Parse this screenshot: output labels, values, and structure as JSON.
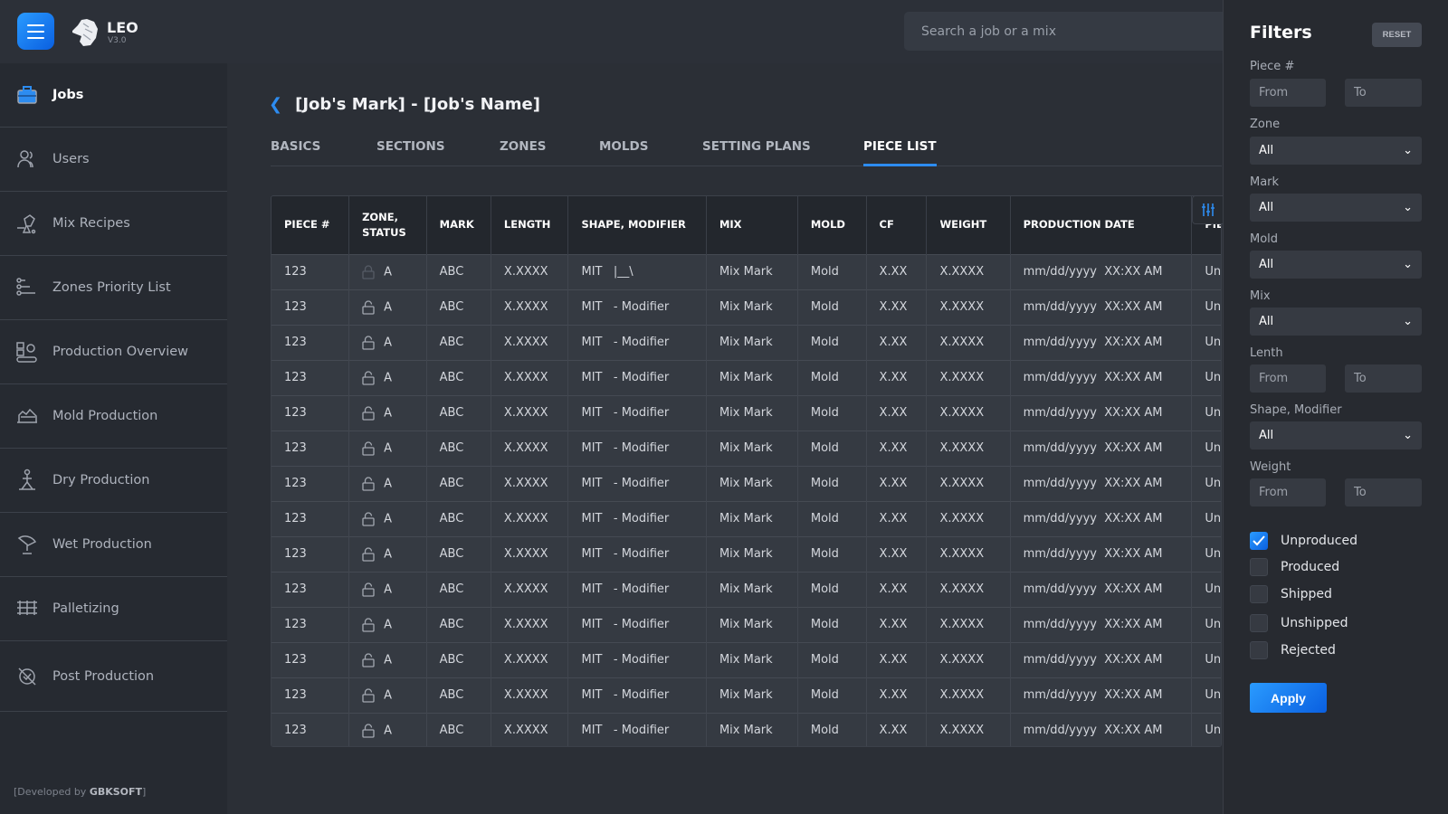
{
  "app": {
    "name": "LEO",
    "version": "V3.0",
    "search_placeholder": "Search a job or a mix"
  },
  "colors": {
    "accent": "#2d8cf0",
    "background": "#2b2f36",
    "sidebar": "#262a31"
  },
  "sidebar": {
    "items": [
      {
        "label": "Jobs",
        "icon": "briefcase-icon",
        "active": true
      },
      {
        "label": "Users",
        "icon": "users-icon"
      },
      {
        "label": "Mix Recipes",
        "icon": "mixer-icon"
      },
      {
        "label": "Zones Priority List",
        "icon": "priority-list-icon"
      },
      {
        "label": "Production Overview",
        "icon": "production-overview-icon"
      },
      {
        "label": "Mold Production",
        "icon": "mold-icon"
      },
      {
        "label": "Dry Production",
        "icon": "dry-production-icon"
      },
      {
        "label": "Wet Production",
        "icon": "wet-production-icon"
      },
      {
        "label": "Palletizing",
        "icon": "pallet-icon"
      },
      {
        "label": "Post Production",
        "icon": "post-production-icon"
      }
    ],
    "credit_prefix": "[Developed by ",
    "credit_brand": "GBKSOFT",
    "credit_suffix": "]"
  },
  "page": {
    "title": "[Job's Mark] - [Job's Name]",
    "tabs": [
      {
        "label": "BASICS"
      },
      {
        "label": "SECTIONS"
      },
      {
        "label": "ZONES"
      },
      {
        "label": "MOLDS"
      },
      {
        "label": "SETTING PLANS"
      },
      {
        "label": "PIECE LIST",
        "active": true
      }
    ]
  },
  "table": {
    "columns": [
      "PIECE #",
      "ZONE,\nSTATUS",
      "MARK",
      "LENGTH",
      "SHAPE, MODIFIER",
      "MIX",
      "MOLD",
      "CF",
      "WEIGHT",
      "PRODUCTION DATE",
      "PIECE STATUS"
    ],
    "rows": [
      {
        "piece": "123",
        "locked": true,
        "zone": "A",
        "mark": "ABC",
        "length": "X.XXXX",
        "shape": "MIT",
        "modifier": "|__\\",
        "mix": "Mix Mark",
        "mold": "Mold",
        "cf": "X.XX",
        "weight": "X.XXXX",
        "date": "mm/dd/yyyy  XX:XX AM",
        "status": "Unpalletized"
      },
      {
        "piece": "123",
        "locked": false,
        "zone": "A",
        "mark": "ABC",
        "length": "X.XXXX",
        "shape": "MIT",
        "modifier": "- Modifier",
        "mix": "Mix Mark",
        "mold": "Mold",
        "cf": "X.XX",
        "weight": "X.XXXX",
        "date": "mm/dd/yyyy  XX:XX AM",
        "status": "Unpalletized"
      },
      {
        "piece": "123",
        "locked": false,
        "zone": "A",
        "mark": "ABC",
        "length": "X.XXXX",
        "shape": "MIT",
        "modifier": "- Modifier",
        "mix": "Mix Mark",
        "mold": "Mold",
        "cf": "X.XX",
        "weight": "X.XXXX",
        "date": "mm/dd/yyyy  XX:XX AM",
        "status": "Unpalletized"
      },
      {
        "piece": "123",
        "locked": false,
        "zone": "A",
        "mark": "ABC",
        "length": "X.XXXX",
        "shape": "MIT",
        "modifier": "- Modifier",
        "mix": "Mix Mark",
        "mold": "Mold",
        "cf": "X.XX",
        "weight": "X.XXXX",
        "date": "mm/dd/yyyy  XX:XX AM",
        "status": "Unpalletized"
      },
      {
        "piece": "123",
        "locked": false,
        "zone": "A",
        "mark": "ABC",
        "length": "X.XXXX",
        "shape": "MIT",
        "modifier": "- Modifier",
        "mix": "Mix Mark",
        "mold": "Mold",
        "cf": "X.XX",
        "weight": "X.XXXX",
        "date": "mm/dd/yyyy  XX:XX AM",
        "status": "Unpalletized"
      },
      {
        "piece": "123",
        "locked": false,
        "zone": "A",
        "mark": "ABC",
        "length": "X.XXXX",
        "shape": "MIT",
        "modifier": "- Modifier",
        "mix": "Mix Mark",
        "mold": "Mold",
        "cf": "X.XX",
        "weight": "X.XXXX",
        "date": "mm/dd/yyyy  XX:XX AM",
        "status": "Unpalletized"
      },
      {
        "piece": "123",
        "locked": false,
        "zone": "A",
        "mark": "ABC",
        "length": "X.XXXX",
        "shape": "MIT",
        "modifier": "- Modifier",
        "mix": "Mix Mark",
        "mold": "Mold",
        "cf": "X.XX",
        "weight": "X.XXXX",
        "date": "mm/dd/yyyy  XX:XX AM",
        "status": "Unpalletized"
      },
      {
        "piece": "123",
        "locked": false,
        "zone": "A",
        "mark": "ABC",
        "length": "X.XXXX",
        "shape": "MIT",
        "modifier": "- Modifier",
        "mix": "Mix Mark",
        "mold": "Mold",
        "cf": "X.XX",
        "weight": "X.XXXX",
        "date": "mm/dd/yyyy  XX:XX AM",
        "status": "Unpalletized"
      },
      {
        "piece": "123",
        "locked": false,
        "zone": "A",
        "mark": "ABC",
        "length": "X.XXXX",
        "shape": "MIT",
        "modifier": "- Modifier",
        "mix": "Mix Mark",
        "mold": "Mold",
        "cf": "X.XX",
        "weight": "X.XXXX",
        "date": "mm/dd/yyyy  XX:XX AM",
        "status": "Unpalletized"
      },
      {
        "piece": "123",
        "locked": false,
        "zone": "A",
        "mark": "ABC",
        "length": "X.XXXX",
        "shape": "MIT",
        "modifier": "- Modifier",
        "mix": "Mix Mark",
        "mold": "Mold",
        "cf": "X.XX",
        "weight": "X.XXXX",
        "date": "mm/dd/yyyy  XX:XX AM",
        "status": "Unpalletized"
      },
      {
        "piece": "123",
        "locked": false,
        "zone": "A",
        "mark": "ABC",
        "length": "X.XXXX",
        "shape": "MIT",
        "modifier": "- Modifier",
        "mix": "Mix Mark",
        "mold": "Mold",
        "cf": "X.XX",
        "weight": "X.XXXX",
        "date": "mm/dd/yyyy  XX:XX AM",
        "status": "Unpalletized"
      },
      {
        "piece": "123",
        "locked": false,
        "zone": "A",
        "mark": "ABC",
        "length": "X.XXXX",
        "shape": "MIT",
        "modifier": "- Modifier",
        "mix": "Mix Mark",
        "mold": "Mold",
        "cf": "X.XX",
        "weight": "X.XXXX",
        "date": "mm/dd/yyyy  XX:XX AM",
        "status": "Unpalletized"
      },
      {
        "piece": "123",
        "locked": false,
        "zone": "A",
        "mark": "ABC",
        "length": "X.XXXX",
        "shape": "MIT",
        "modifier": "- Modifier",
        "mix": "Mix Mark",
        "mold": "Mold",
        "cf": "X.XX",
        "weight": "X.XXXX",
        "date": "mm/dd/yyyy  XX:XX AM",
        "status": "Unpalletized"
      },
      {
        "piece": "123",
        "locked": false,
        "zone": "A",
        "mark": "ABC",
        "length": "X.XXXX",
        "shape": "MIT",
        "modifier": "- Modifier",
        "mix": "Mix Mark",
        "mold": "Mold",
        "cf": "X.XX",
        "weight": "X.XXXX",
        "date": "mm/dd/yyyy  XX:XX AM",
        "status": "Unpalletized"
      }
    ]
  },
  "filters": {
    "title": "Filters",
    "reset_label": "RESET",
    "piece": {
      "label": "Piece #",
      "from_placeholder": "From",
      "to_placeholder": "To"
    },
    "zone": {
      "label": "Zone",
      "value": "All"
    },
    "mark": {
      "label": "Mark",
      "value": "All"
    },
    "mold": {
      "label": "Mold",
      "value": "All"
    },
    "mix": {
      "label": "Mix",
      "value": "All"
    },
    "length": {
      "label": "Lenth",
      "from_placeholder": "From",
      "to_placeholder": "To"
    },
    "shape": {
      "label": "Shape, Modifier",
      "value": "All"
    },
    "weight": {
      "label": "Weight",
      "from_placeholder": "From",
      "to_placeholder": "To"
    },
    "checkboxes": [
      {
        "label": "Unproduced",
        "checked": true
      },
      {
        "label": "Produced",
        "checked": false
      },
      {
        "label": "Shipped",
        "checked": false
      },
      {
        "label": "Unshipped",
        "checked": false
      },
      {
        "label": "Rejected",
        "checked": false
      }
    ],
    "apply_label": "Apply"
  }
}
